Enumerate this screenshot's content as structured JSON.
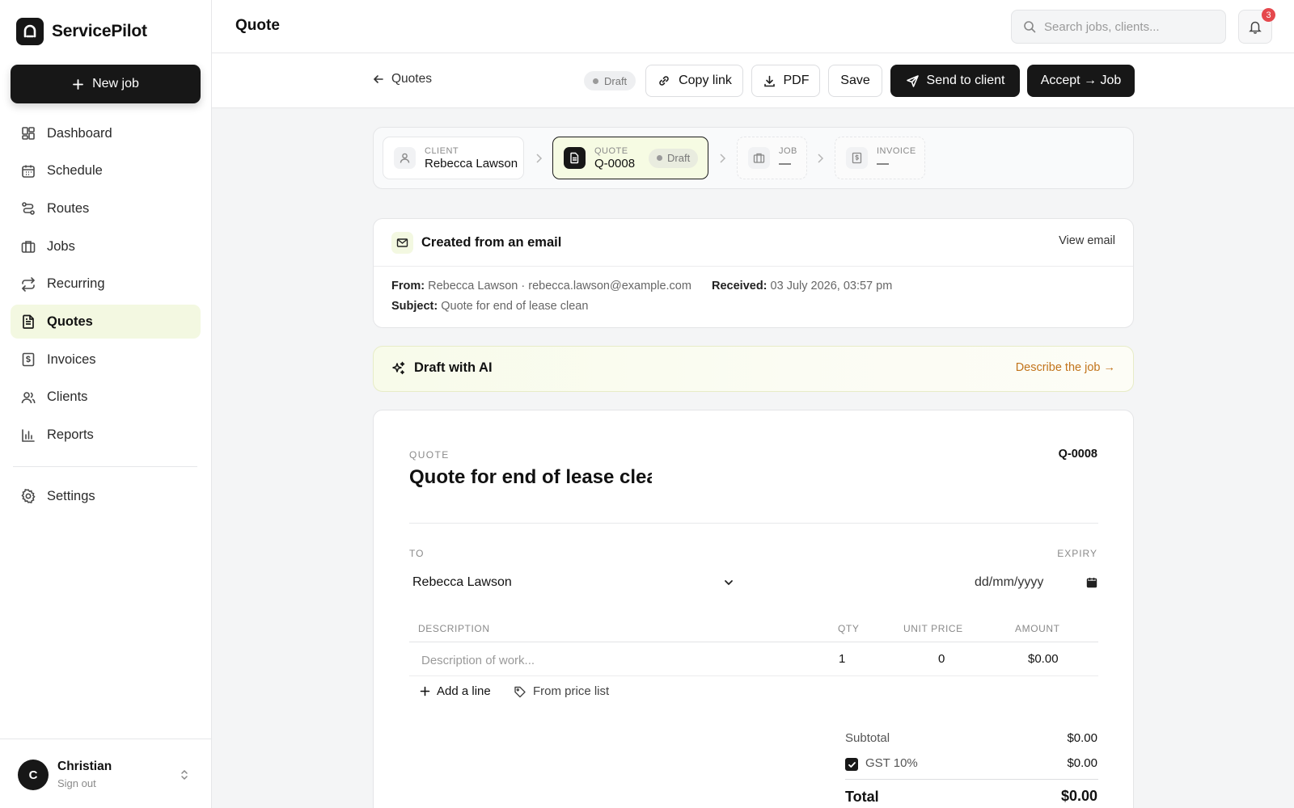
{
  "app": {
    "name": "ServicePilot"
  },
  "sidebar": {
    "new_job_label": "New job",
    "items": [
      {
        "label": "Dashboard",
        "icon": "dashboard-icon"
      },
      {
        "label": "Schedule",
        "icon": "calendar-icon"
      },
      {
        "label": "Routes",
        "icon": "route-icon"
      },
      {
        "label": "Jobs",
        "icon": "briefcase-icon"
      },
      {
        "label": "Recurring",
        "icon": "repeat-icon"
      },
      {
        "label": "Quotes",
        "icon": "document-icon",
        "active": true
      },
      {
        "label": "Invoices",
        "icon": "receipt-icon"
      },
      {
        "label": "Clients",
        "icon": "users-icon"
      },
      {
        "label": "Reports",
        "icon": "bar-chart-icon"
      }
    ],
    "settings_label": "Settings",
    "user": {
      "initial": "C",
      "name": "Christian",
      "sub": "Sign out"
    }
  },
  "header": {
    "title": "Quote",
    "search_placeholder": "Search jobs, clients...",
    "notifications_count": "3"
  },
  "actionbar": {
    "back_label": "Quotes",
    "status": "Draft",
    "copy_link": "Copy link",
    "pdf": "PDF",
    "save": "Save",
    "send": "Send to client",
    "accept": "Accept → Job"
  },
  "pipeline": {
    "client": {
      "label": "CLIENT",
      "value": "Rebecca Lawson"
    },
    "quote": {
      "label": "QUOTE",
      "value": "Q-0008",
      "status": "Draft"
    },
    "job": {
      "label": "JOB",
      "value": "—"
    },
    "invoice": {
      "label": "INVOICE",
      "value": "—"
    }
  },
  "email": {
    "title": "Created from an email",
    "view_label": "View email",
    "from_label": "From:",
    "from_value": "Rebecca Lawson · rebecca.lawson@example.com",
    "received_label": "Received:",
    "received_value": "03 July 2026, 03:57 pm",
    "subject_label": "Subject:",
    "subject_value": "Quote for end of lease clean"
  },
  "ai": {
    "title": "Draft with AI",
    "link": "Describe the job →",
    "accent": "#c2741b"
  },
  "quote": {
    "label": "QUOTE",
    "number": "Q-0008",
    "title": "Quote for end of lease clean",
    "to_label": "TO",
    "to_value": "Rebecca Lawson",
    "expiry_label": "EXPIRY",
    "expiry_value": "dd/mm/yyyy",
    "columns": {
      "description": "DESCRIPTION",
      "qty": "QTY",
      "unit_price": "UNIT PRICE",
      "amount": "AMOUNT"
    },
    "line": {
      "placeholder": "Description of work...",
      "qty": "1",
      "unit_price": "0",
      "amount": "$0.00"
    },
    "add_line": "Add a line",
    "price_list": "From price list",
    "subtotal_label": "Subtotal",
    "subtotal": "$0.00",
    "gst_label": "GST 10%",
    "gst": "$0.00",
    "total_label": "Total",
    "total": "$0.00"
  }
}
